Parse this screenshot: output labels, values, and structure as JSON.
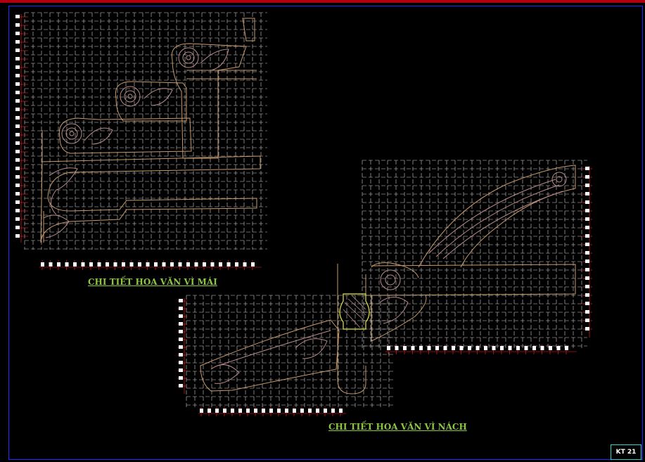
{
  "labels": {
    "roof_detail": "CHI TIẾT HOA VĂN VÌ MÁI",
    "arm_detail": "CHI TIẾT HOA VĂN VÌ NÁCH"
  },
  "sheet_number": "KT 21",
  "colors": {
    "background": "#000000",
    "grid": "#cfcfcf",
    "outline": "#c99a6a",
    "ornament": "#b98a8a",
    "label": "#8cc63f",
    "highlight": "#e8e84a",
    "dimension": "#ff2020",
    "frame": "#1a2cff",
    "sheet_box": "#2fd0d0"
  }
}
